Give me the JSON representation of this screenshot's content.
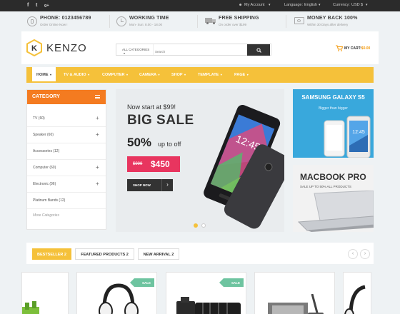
{
  "topbar": {
    "social": [
      "f",
      "t",
      "g+"
    ],
    "account": "My Account",
    "language_label": "Language:",
    "language_value": "English",
    "currency_label": "Currency:",
    "currency_value": "USD $"
  },
  "info": [
    {
      "title": "PHONE: 0123456789",
      "sub": "Order Online Now !",
      "icon": "phone-icon"
    },
    {
      "title": "WORKING TIME",
      "sub": "Mon- Sun: 8.00 - 18.00",
      "icon": "clock-icon"
    },
    {
      "title": "FREE SHIPPING",
      "sub": "On order over $199",
      "icon": "truck-icon"
    },
    {
      "title": "MONEY BACK 100%",
      "sub": "Within 30 Days after delivery",
      "icon": "money-icon"
    }
  ],
  "header": {
    "logo": "KENZO",
    "logo_letter": "K",
    "category_select": "ALL CATEGORIES",
    "search_placeholder": "Search",
    "cart_label": "MY CART:",
    "cart_amount": "$0.00"
  },
  "nav": [
    "HOME",
    "TV & AUDIO",
    "COMPUTER",
    "CAMERA",
    "SHOP",
    "TEMPLATE",
    "PAGE"
  ],
  "sidebar": {
    "title": "CATEGORY",
    "items": [
      {
        "label": "TV (60)",
        "expand": "+"
      },
      {
        "label": "Speaker (60)",
        "expand": "+"
      },
      {
        "label": "Accessories (12)",
        "expand": ""
      },
      {
        "label": "Computer (60)",
        "expand": "+"
      },
      {
        "label": "Electronic (96)",
        "expand": "+"
      },
      {
        "label": "Platinum Bands (12)",
        "expand": ""
      }
    ],
    "more": "More Categories"
  },
  "slider": {
    "line1": "Now start at $99!",
    "line2": "BIG SALE",
    "percent": "50%",
    "upto": "up to off",
    "old_price": "$999",
    "new_price": "$450",
    "button": "SHOP NOW"
  },
  "banners": {
    "b1_title": "SAMSUNG GALAXY S5",
    "b1_sub": "Bigger than bigger",
    "b2_title": "MACBOOK PRO",
    "b2_sub": "SALE UP TO 50% ALL PRODUCTS"
  },
  "tabs": [
    "BESTSELLER 2",
    "FEATURED PRODUCTS 2",
    "NEW ARRIVAL 2"
  ],
  "products": {
    "sale_label": "SALE"
  },
  "colors": {
    "accent": "#f5c13a",
    "orange": "#f47b20",
    "pink": "#e8355f",
    "blue": "#39a8dc",
    "sale": "#6ec4a0"
  }
}
